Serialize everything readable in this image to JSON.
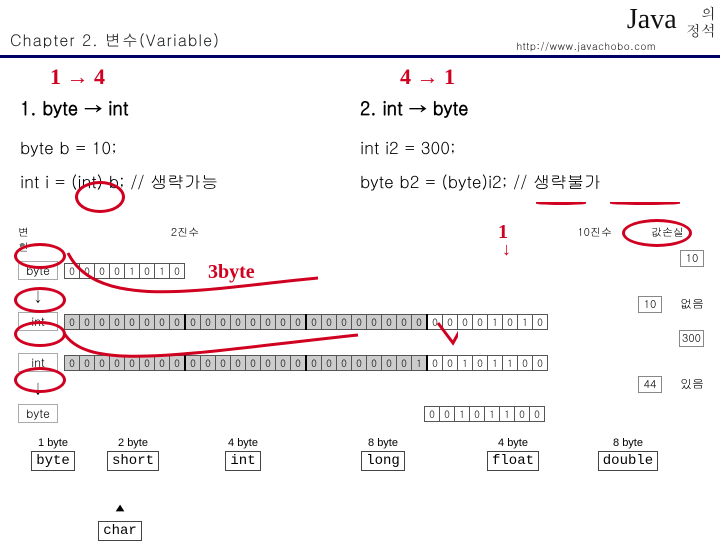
{
  "header": {
    "chapter": "Chapter 2. 변수(Variable)",
    "brand_java": "Java",
    "brand_ko_top": "의",
    "brand_ko_bot": "정석",
    "url": "http://www.javachobo.com"
  },
  "left": {
    "title": "1. byte → int",
    "code1": "byte b = 10;",
    "code2": "int i =  (int) b; // 생략가능",
    "red_top": "1 → 4"
  },
  "right": {
    "title": "2. int → byte",
    "code1": "int i2 = 300;",
    "code2": "byte b2 = (byte)i2; // 생략불가",
    "red_top": "4 → 1"
  },
  "table": {
    "hdr_left": "변환",
    "hdr_mid": "2진수",
    "hdr_right": "10진수",
    "hdr_loss": "값손실",
    "types": [
      "byte",
      "int",
      "int",
      "byte"
    ],
    "byte_bits_a": [
      "0",
      "0",
      "0",
      "0",
      "1",
      "0",
      "1",
      "0"
    ],
    "int_bits_a": [
      "0",
      "0",
      "0",
      "0",
      "0",
      "0",
      "0",
      "0",
      "0",
      "0",
      "0",
      "0",
      "0",
      "0",
      "0",
      "0",
      "0",
      "0",
      "0",
      "0",
      "0",
      "0",
      "0",
      "0",
      "0",
      "0",
      "0",
      "0",
      "1",
      "0",
      "1",
      "0"
    ],
    "int_bits_b": [
      "0",
      "0",
      "0",
      "0",
      "0",
      "0",
      "0",
      "0",
      "0",
      "0",
      "0",
      "0",
      "0",
      "0",
      "0",
      "0",
      "0",
      "0",
      "0",
      "0",
      "0",
      "0",
      "0",
      "1",
      "0",
      "0",
      "1",
      "0",
      "1",
      "1",
      "0",
      "0"
    ],
    "byte_bits_b": [
      "0",
      "0",
      "1",
      "0",
      "1",
      "1",
      "0",
      "0"
    ],
    "dec_a1": "10",
    "dec_a2": "10",
    "dec_b1": "300",
    "dec_b2": "44",
    "loss_a": "없음",
    "loss_b": "있음",
    "red_3byte": "3byte",
    "red_arrow": "↓",
    "red_one": "1"
  },
  "sizes": {
    "labels": [
      "1 byte",
      "2 byte",
      "4 byte",
      "8 byte",
      "4 byte",
      "8 byte"
    ],
    "names": [
      "byte",
      "short",
      "int",
      "long",
      "float",
      "double"
    ],
    "char": "char",
    "tri": "▲"
  }
}
